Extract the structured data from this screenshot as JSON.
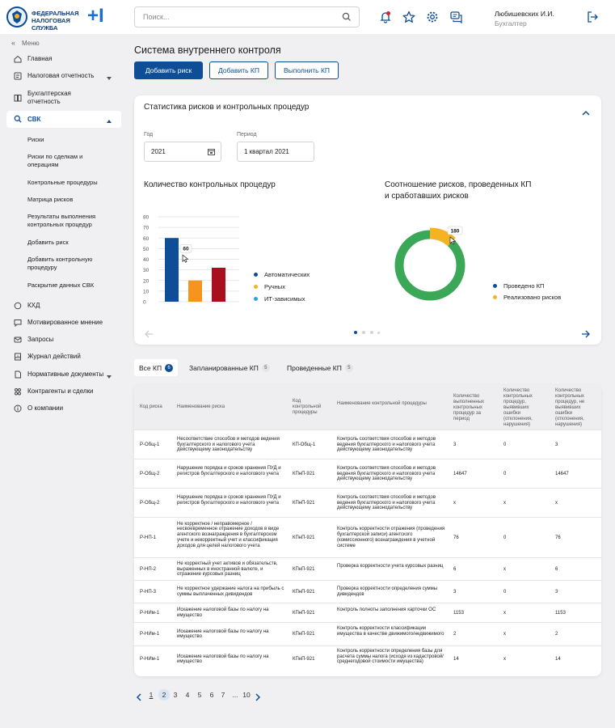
{
  "brand": {
    "line1": "ФЕДЕРАЛЬНАЯ",
    "line2": "НАЛОГОВАЯ СЛУЖБА",
    "plus": "+I"
  },
  "search": {
    "placeholder": "Поиск..."
  },
  "user": {
    "name": "Любишевских И.И.",
    "role": "Бухгалтер"
  },
  "sidebar": {
    "menu_label": "Меню",
    "items": [
      {
        "label": "Главная",
        "icon": "home-icon"
      },
      {
        "label": "Налоговая отчетность",
        "icon": "report-icon"
      },
      {
        "label": "Бухгалтерская отчетность",
        "icon": "book-icon"
      },
      {
        "label": "СВК",
        "icon": "search-doc-icon",
        "active": true
      },
      {
        "label": "КХД",
        "icon": "coin-icon"
      },
      {
        "label": "Мотивированное мнение",
        "icon": "chat-icon"
      },
      {
        "label": "Запросы",
        "icon": "request-icon"
      },
      {
        "label": "Журнал действий",
        "icon": "journal-icon"
      },
      {
        "label": "Нормативные документы",
        "icon": "docs-icon"
      },
      {
        "label": "Контрагенты и сделки",
        "icon": "partners-icon"
      },
      {
        "label": "О компании",
        "icon": "info-icon"
      }
    ],
    "sub_items": [
      "Риски",
      "Риски по сделкам и операциям",
      "Контрольные процедуры",
      "Матрица рисков",
      "Результаты выполнения контрольных процедур",
      "Добавить риск",
      "Добавить контрольную процедуру",
      "Раскрытие данных СВК"
    ]
  },
  "page": {
    "title": "Система внутреннего контроля"
  },
  "actions": {
    "add_risk": "Добавить риск",
    "add_kp": "Добавить КП",
    "run_kp": "Выполнить КП"
  },
  "stats": {
    "title": "Статистика рисков и контрольных процедур",
    "year_label": "Год",
    "year_value": "2021",
    "period_label": "Период",
    "period_value": "1 квартал 2021",
    "bar_title": "Количество контрольных процедур",
    "donut_title_1": "Соотношение рисков, проведенных КП",
    "donut_title_2": "и сработавших рисков"
  },
  "chart_data": [
    {
      "type": "bar",
      "title": "Количество контрольных процедур",
      "yticks": [
        "0",
        "10",
        "20",
        "30",
        "40",
        "50",
        "60",
        "70",
        "80"
      ],
      "ylim": [
        0,
        80
      ],
      "series": [
        {
          "name": "Автоматических",
          "value": 60,
          "color": "#0e4e96"
        },
        {
          "name": "Ручных",
          "value": 20,
          "color": "#f7941d"
        },
        {
          "name": "ИТ-зависимых",
          "value": 32,
          "color": "#a8101e"
        }
      ],
      "legend_colors": [
        "#0e4e96",
        "#f5b324",
        "#2aa4e0"
      ],
      "tooltip": "60",
      "grid": true
    },
    {
      "type": "pie",
      "title": "Соотношение рисков, проведенных КП и сработавших рисков",
      "slices": [
        {
          "name": "Проведено КП",
          "value": 88,
          "color": "#3aa856"
        },
        {
          "name": "Реализовано рисков",
          "value": 12,
          "color": "#f5b324"
        }
      ],
      "legend_colors": [
        "#0e4e96",
        "#f5b324"
      ],
      "tooltip": "180"
    }
  ],
  "tabs": [
    {
      "label": "Все КП",
      "count": "6"
    },
    {
      "label": "Запланированные КП",
      "count": "5"
    },
    {
      "label": "Проведенные КП",
      "count": "5"
    }
  ],
  "table": {
    "headers": [
      "Код риска",
      "Наименование риска",
      "Код контрольной процедуры",
      "Наименование контрольной процедуры",
      "Количество выполненных контрольных процедур за период",
      "Количество контрольных процедур, выявивших ошибки (отклонения, нарушения)",
      "Количество контрольных процедур, не выявивших ошибки (отклонения, нарушения)"
    ],
    "rows": [
      [
        "Р-Общ-1",
        "Несоответствие способов и методов ведения бухгалтерского и налогового учета действующему законодательству",
        "КП-Общ-1",
        "Контроль соответствия способов и методов ведения бухгалтерского и налогового учета действующему законодательству",
        "3",
        "0",
        "3"
      ],
      [
        "Р-Общ-2",
        "Нарушение порядка и сроков хранения ПУД и регистров бухгалтерского и налогового учета",
        "КПнП-921",
        "Контроль соответствия способов и методов ведения бухгалтерского и налогового учета действующему законодательству",
        "14647",
        "0",
        "14647"
      ],
      [
        "Р-Общ-2",
        "Нарушение порядка и сроков хранения ПУД и регистров бухгалтерского и налогового учета",
        "КПнП-921",
        "Контроль соответствия способов и методов ведения бухгалтерского и налогового учета действующему законодательству",
        "x",
        "x",
        "x"
      ],
      [
        "Р-НП-1",
        "Не корректное / неправомерное / несвоевременное отражение доходов в виде агентского вознаграждения в бухгалтерском учете и некорректный учет и классификация доходов для целей налогового учета",
        "КПнП-921",
        "Контроль корректности отражения (проведения бухгалтерской записи) агентского (комиссионного) вознаграждения в учетной системе",
        "76",
        "0",
        "76"
      ],
      [
        "Р-НП-2",
        "Не корректный учет активов и обязательств, выраженных в иностранной валюте, и отражение курсовых разниц",
        "КПнП-921",
        "Проверка корректности учета курсовых разниц",
        "6",
        "x",
        "6"
      ],
      [
        "Р-НП-3",
        "Не корректное удержание налога на прибыль с суммы выплаченных дивидендов",
        "КПнП-921",
        "Проверка корректности определения суммы дивидендов",
        "3",
        "0",
        "3"
      ],
      [
        "Р-НИм-1",
        "Искажение налоговой базы по налогу на имущество",
        "КПнП-921",
        "Контроль полноты заполнения карточки ОС",
        "1153",
        "x",
        "1153"
      ],
      [
        "Р-НИм-1",
        "Искажение налоговой базы по налогу на имущество",
        "КПнП-921",
        "Контроль корректности классификации имущества в качестве движимого/недвижимого",
        "2",
        "x",
        "2"
      ],
      [
        "Р-НИм-1",
        "Искажение налоговой базы по налогу на имущество",
        "КПнП-921",
        "Контроль корректности определения базы для расчета суммы налога (исходя из кадастровой/среднегодовой стоимости имущества)",
        "14",
        "x",
        "14"
      ]
    ]
  },
  "pagination": {
    "pages": [
      "1",
      "2",
      "3",
      "4",
      "5",
      "6",
      "7",
      "...",
      "10"
    ],
    "current": "1"
  }
}
